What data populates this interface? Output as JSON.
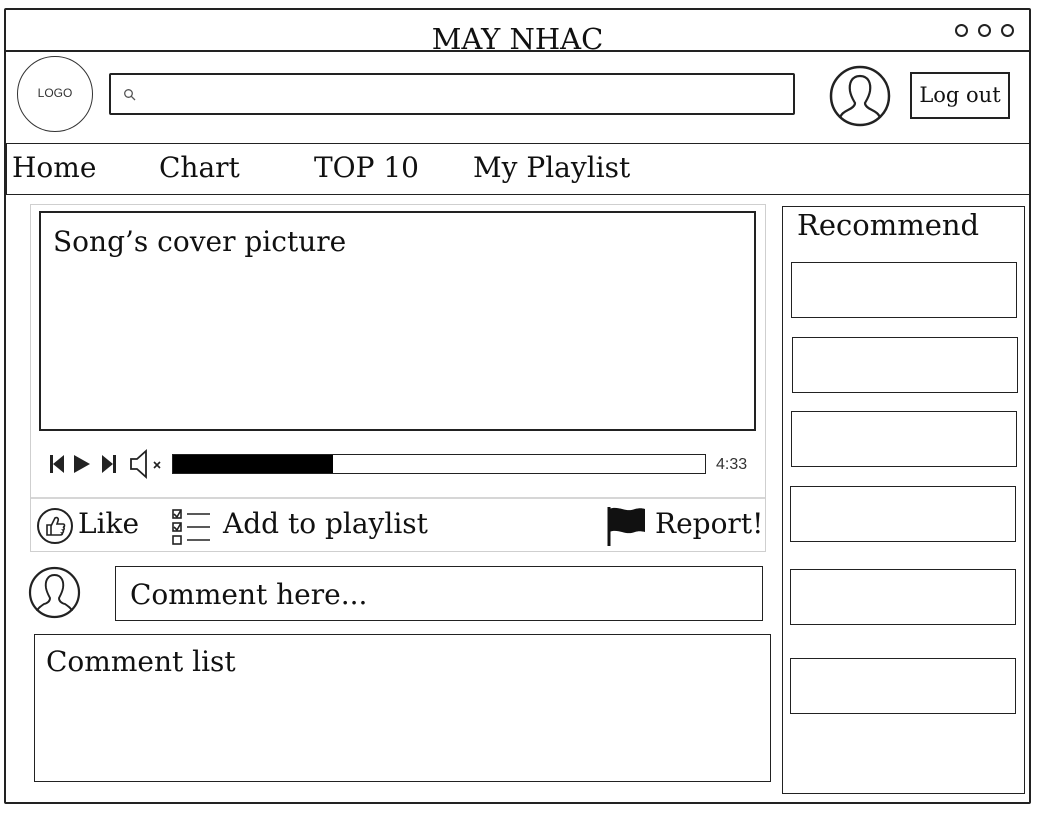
{
  "window": {
    "title": "MAY NHAC"
  },
  "header": {
    "logo_text": "LOGO",
    "search_placeholder": "",
    "logout_label": "Log out"
  },
  "nav": {
    "items": [
      "Home",
      "Chart",
      "TOP 10",
      "My Playlist"
    ]
  },
  "player": {
    "cover_label": "Song’s cover picture",
    "duration": "4:33",
    "progress_fraction": 0.3
  },
  "actions": {
    "like_label": "Like",
    "add_playlist_label": "Add to playlist",
    "report_label": "Report!"
  },
  "comments": {
    "input_placeholder": "Comment here...",
    "list_label": "Comment list"
  },
  "recommend": {
    "title": "Recommend",
    "item_count": 6
  },
  "icons": [
    "search-icon",
    "user-avatar-icon",
    "previous-icon",
    "play-icon",
    "next-icon",
    "mute-icon",
    "thumbs-up-icon",
    "checklist-icon",
    "flag-icon"
  ]
}
